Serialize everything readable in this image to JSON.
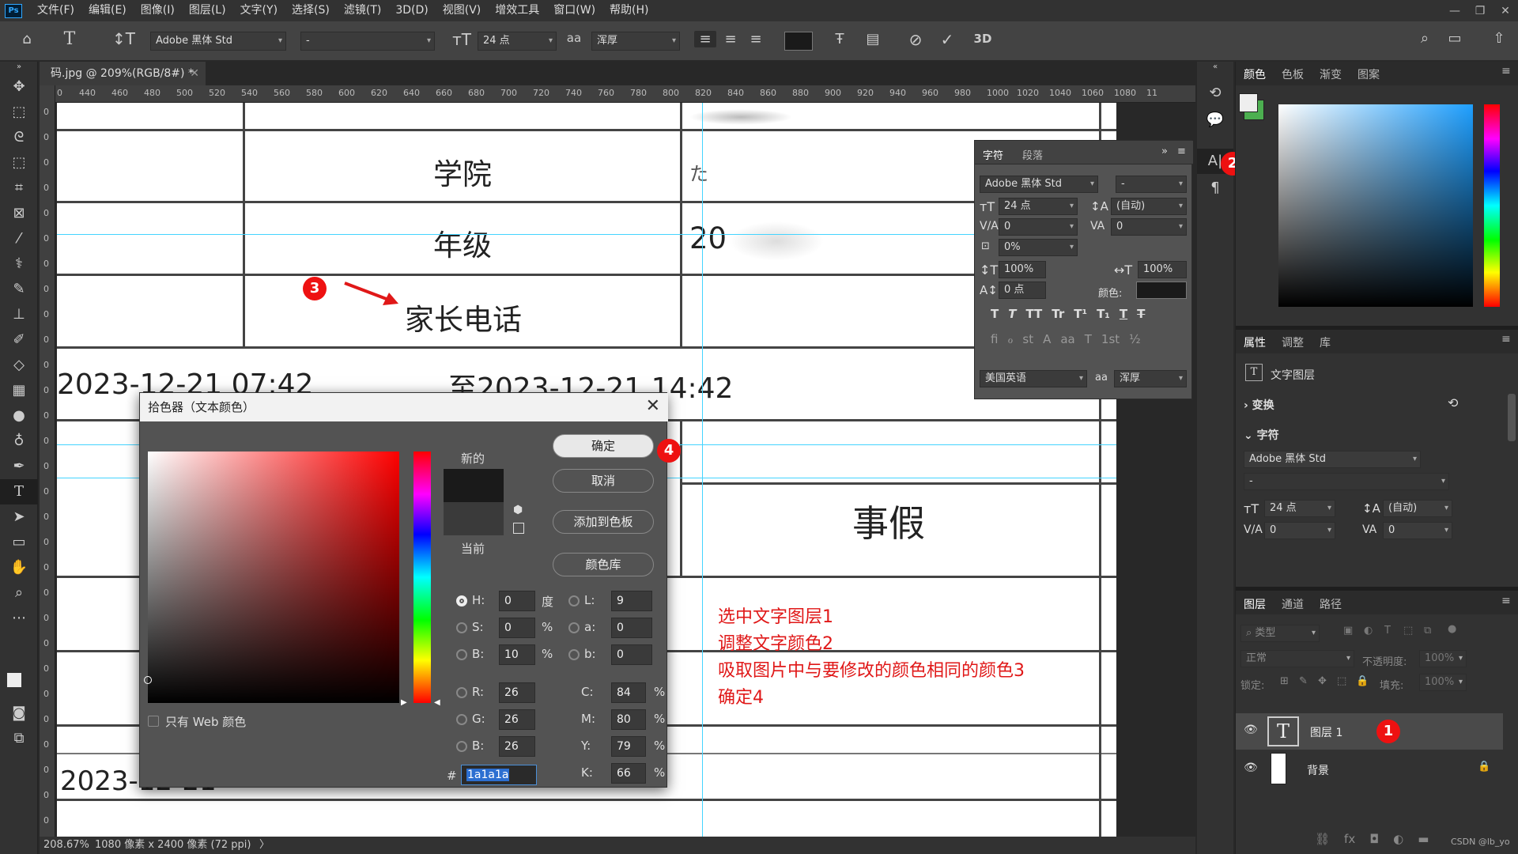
{
  "menubar": {
    "logo": "Ps",
    "items": [
      "文件(F)",
      "编辑(E)",
      "图像(I)",
      "图层(L)",
      "文字(Y)",
      "选择(S)",
      "滤镜(T)",
      "3D(D)",
      "视图(V)",
      "增效工具",
      "窗口(W)",
      "帮助(H)"
    ]
  },
  "options": {
    "font_family": "Adobe 黑体 Std",
    "font_style": "-",
    "font_size": "24 点",
    "aa_label": "aa",
    "antialias": "浑厚",
    "mode_3d": "3D"
  },
  "document": {
    "tab_label": "码.jpg @ 209%(RGB/8#) *",
    "ruler_ticks": [
      "0",
      "440",
      "460",
      "480",
      "500",
      "520",
      "540",
      "560",
      "580",
      "600",
      "620",
      "640",
      "660",
      "680",
      "700",
      "720",
      "740",
      "760",
      "780",
      "800",
      "820",
      "840",
      "860",
      "880",
      "900",
      "920",
      "940",
      "960",
      "980",
      "1000",
      "1020",
      "1040",
      "1060",
      "1080",
      "11"
    ],
    "v_ruler_ticks": [
      "0",
      "0",
      "0",
      "0",
      "0",
      "0",
      "0",
      "0",
      "0",
      "0",
      "0",
      "0",
      "0",
      "0",
      "0",
      "0",
      "0",
      "0",
      "0",
      "0",
      "0",
      "0",
      "0",
      "0",
      "0",
      "0",
      "0",
      "0",
      "0"
    ],
    "cells": {
      "college_label": "学院",
      "grade_label": "年级",
      "grade_value": "20",
      "parent_phone_label": "家长电话",
      "time_start": "2023-12-21 07:42",
      "time_to": "至2023-12-21 14:42",
      "leave_type": "事假",
      "bottom_date": "2023-12-21",
      "college_value": "た"
    },
    "annotations": [
      "选中文字图层1",
      "调整文字颜色2",
      "吸取图片中与要修改的颜色相同的颜色3",
      "确定4"
    ],
    "badges": [
      "1",
      "2",
      "3",
      "4"
    ]
  },
  "status": {
    "zoom": "208.67%",
    "size": "1080 像素 x 2400 像素 (72 ppi)",
    "arrow": "〉"
  },
  "color_picker": {
    "title": "拾色器（文本颜色）",
    "new_label": "新的",
    "current_label": "当前",
    "new_color": "#1a1a1a",
    "current_color": "#3a3a3a",
    "buttons": {
      "ok": "确定",
      "cancel": "取消",
      "add_swatch": "添加到色板",
      "color_library": "颜色库"
    },
    "web_only": "只有 Web 颜色",
    "hsb": {
      "h_label": "H:",
      "h": "0",
      "h_unit": "度",
      "s_label": "S:",
      "s": "0",
      "s_unit": "%",
      "b_label": "B:",
      "b": "10",
      "b_unit": "%"
    },
    "lab": {
      "l_label": "L:",
      "l": "9",
      "a_label": "a:",
      "a": "0",
      "b_label": "b:",
      "b": "0"
    },
    "rgb": {
      "r_label": "R:",
      "r": "26",
      "g_label": "G:",
      "g": "26",
      "b_label": "B:",
      "b": "26"
    },
    "cmyk": {
      "c_label": "C:",
      "c": "84",
      "m_label": "M:",
      "m": "80",
      "y_label": "Y:",
      "y": "79",
      "k_label": "K:",
      "k": "66",
      "unit": "%"
    },
    "hex_label": "#",
    "hex": "1a1a1a"
  },
  "character_panel": {
    "tabs": [
      "字符",
      "段落"
    ],
    "font_family": "Adobe 黑体 Std",
    "font_style": "-",
    "size": "24 点",
    "leading": "(自动)",
    "kerning": "0",
    "tracking": "0",
    "scale_pct": "0%",
    "vscale": "100%",
    "hscale": "100%",
    "baseline": "0 点",
    "color_label": "颜色:",
    "language": "美国英语",
    "aa_label": "aa",
    "antialias": "浑厚",
    "style_buttons": [
      "T",
      "T",
      "TT",
      "Tr",
      "T¹",
      "T₁",
      "T",
      "T"
    ],
    "ot_buttons": [
      "fi",
      "ℴ",
      "st",
      "A",
      "aa",
      "T",
      "1st",
      "½"
    ]
  },
  "color_panel": {
    "tabs": [
      "颜色",
      "色板",
      "渐变",
      "图案"
    ]
  },
  "properties_panel": {
    "tabs": [
      "属性",
      "调整",
      "库"
    ],
    "layer_type": "文字图层",
    "transform": "变换",
    "character": "字符",
    "font_family": "Adobe 黑体 Std",
    "font_style": "-",
    "size": "24 点",
    "leading": "(自动)",
    "kerning": "0",
    "tracking": "0"
  },
  "layers_panel": {
    "tabs": [
      "图层",
      "通道",
      "路径"
    ],
    "filter": "类型",
    "blend_mode": "正常",
    "opacity_label": "不透明度:",
    "opacity": "100%",
    "lock_label": "锁定:",
    "fill_label": "填充:",
    "fill": "100%",
    "layers": [
      {
        "name": "图层 1",
        "type": "text"
      },
      {
        "name": "背景",
        "type": "image"
      }
    ],
    "watermark": "CSDN @lb_yo"
  }
}
